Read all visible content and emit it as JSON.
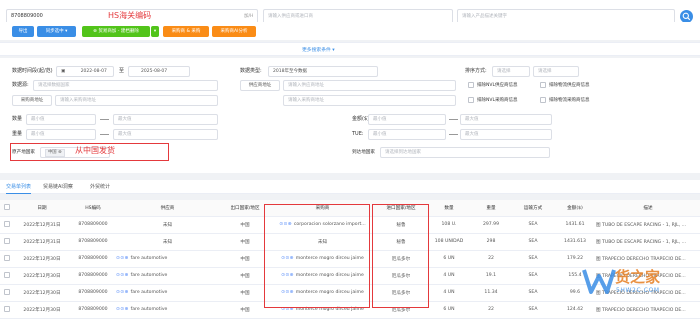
{
  "top": {
    "hs_code_value": "8708809000",
    "unit_label": "加/H",
    "hs_callout": "HS海关编码",
    "importer_placeholder": "请输入供应商或进口商",
    "product_placeholder": "请输入产品描述关键字"
  },
  "toolbar": {
    "export": "导出",
    "sync": "同步选中",
    "to_crm": "⊕ 贸易商加 - 建档删除",
    "search_one": "采购商 & 采购",
    "ai_analysis": "采购商AI分析"
  },
  "more_conditions": "更多搜索条件 ▾",
  "filters": {
    "date_range_label": "数据时间段(起/范)",
    "date_from": "2022-08-07",
    "date_to_sep": "至",
    "date_to": "2025-08-07",
    "data_type_label": "数据类型:",
    "data_type_value": "2018年至今数据",
    "sort_label": "排序方式:",
    "sort_value1": "请选择",
    "sort_value2": "请选择",
    "country_label": "数据源:",
    "country_placeholder": "请选择数据国家",
    "supplier_button": "供应商地址",
    "supplier_addr_placeholder": "请输入供应商地址",
    "buyer_button": "采购商地址",
    "buyer_addr_placeholder": "请输入采购商地址",
    "buyer_addr_placeholder2": "请输入采购商地址",
    "check1": "排除NVL供应商信息",
    "check2": "排除物流供应商信息",
    "check3": "排除NVL采购商信息",
    "check4": "排除物流采购商信息",
    "qty_label": "数量",
    "qty_min": "最小值",
    "qty_max": "最大值",
    "amount_label": "金额($)",
    "amount_min": "最小值",
    "amount_max": "最大值",
    "weight_label": "重量",
    "weight_min": "最小值",
    "weight_max": "最大值",
    "teu_label": "TUE:",
    "teu_min": "最小值",
    "teu_max": "最大值",
    "origin_label": "原产地国家",
    "origin_tag": "中国 ⊗",
    "origin_callout": "从中国发货",
    "arrival_label": "到达地国家",
    "arrival_placeholder": "请选择到达地国家"
  },
  "tabs": [
    "交易单列表",
    "贸易链AI洞察",
    "外贸统计"
  ],
  "table": {
    "headers": [
      "日期",
      "HS编码",
      "供应商",
      "出口国家/地区",
      "采购商",
      "进口国家/地区",
      "数量",
      "重量",
      "运输方式",
      "金额($)",
      "描述"
    ],
    "rows": [
      {
        "date": "2022年12月31日",
        "hs": "8708809000",
        "supplier": "未知",
        "export": "中国",
        "buyer": "corporacion solorzano import...",
        "import": "秘鲁",
        "qty": "108 U.",
        "weight": "297.99",
        "transport": "SEA",
        "amount": "1431.61",
        "desc": "图 TUBO DE ESCAPE RACING - 1, RJL, ..."
      },
      {
        "date": "2022年12月31日",
        "hs": "8708809000",
        "supplier": "未知",
        "export": "中国",
        "buyer": "未知",
        "import": "秘鲁",
        "qty": "108 UNIDAD",
        "weight": "298",
        "transport": "SEA",
        "amount": "1431.613",
        "desc": "图 TUBO DE ESCAPE RACING - 1, RJL, ..."
      },
      {
        "date": "2022年12月30日",
        "hs": "8708809000",
        "supplier": "fare automotive",
        "export": "中国",
        "buyer": "monterce mogro dirceu jaime",
        "import": "厄瓜多尔",
        "qty": "6 UN",
        "weight": "22",
        "transport": "SEA",
        "amount": "179.22",
        "desc": "图 TRAPECIO DERECHO TRAPECIO DE..."
      },
      {
        "date": "2022年12月30日",
        "hs": "8708809000",
        "supplier": "fare automotive",
        "export": "中国",
        "buyer": "monterce mogro dirceu jaime",
        "import": "厄瓜多尔",
        "qty": "4 UN",
        "weight": "19.1",
        "transport": "SEA",
        "amount": "155.4",
        "desc": "图 TRAPECIO DERECHO TRAPECIO DE..."
      },
      {
        "date": "2022年12月30日",
        "hs": "8708809000",
        "supplier": "fare automotive",
        "export": "中国",
        "buyer": "monterce mogro dirceu jaime",
        "import": "厄瓜多尔",
        "qty": "4 UN",
        "weight": "11.34",
        "transport": "SEA",
        "amount": "99.6",
        "desc": "图 TRAPECIO DERECHO TRAPECIO DE..."
      },
      {
        "date": "2022年12月30日",
        "hs": "8708809000",
        "supplier": "fare automotive",
        "export": "中国",
        "buyer": "monterce mogro dirceu jaime",
        "import": "厄瓜多尔",
        "qty": "6 UN",
        "weight": "22",
        "transport": "SEA",
        "amount": "124.42",
        "desc": "图 TRAPECIO DERECHO TRAPECIO DE..."
      }
    ]
  },
  "watermark": {
    "main": "货之家",
    "sub": "5HW2C.COM"
  },
  "colors": {
    "primary": "#3a8ee6",
    "green": "#52c41a",
    "orange": "#fa8c16",
    "callout": "#e4393c"
  }
}
